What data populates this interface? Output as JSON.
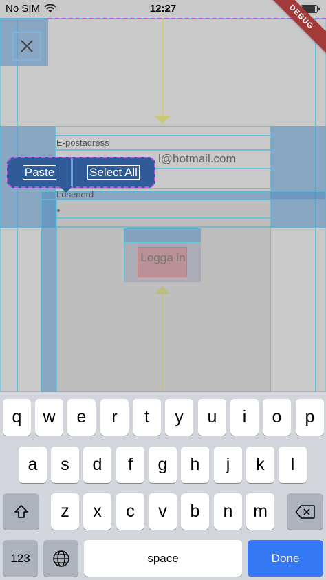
{
  "status_bar": {
    "carrier": "No SIM",
    "time": "12:27"
  },
  "debug_banner": "DEBUG",
  "form": {
    "email_label": "E-postadress",
    "email_value": "l@hotmail.com",
    "password_label": "Lösenord",
    "login_button": "Logga in"
  },
  "context_menu": {
    "paste": "Paste",
    "select_all": "Select All"
  },
  "keyboard": {
    "row1": [
      "q",
      "w",
      "e",
      "r",
      "t",
      "y",
      "u",
      "i",
      "o",
      "p"
    ],
    "row2": [
      "a",
      "s",
      "d",
      "f",
      "g",
      "h",
      "j",
      "k",
      "l"
    ],
    "row3": [
      "z",
      "x",
      "c",
      "v",
      "b",
      "n",
      "m"
    ],
    "numbers": "123",
    "space": "space",
    "done": "Done"
  },
  "colors": {
    "accent_done": "#3478f6",
    "menu_bg": "#2f5c99",
    "debug_ribbon": "#a33a3a"
  }
}
